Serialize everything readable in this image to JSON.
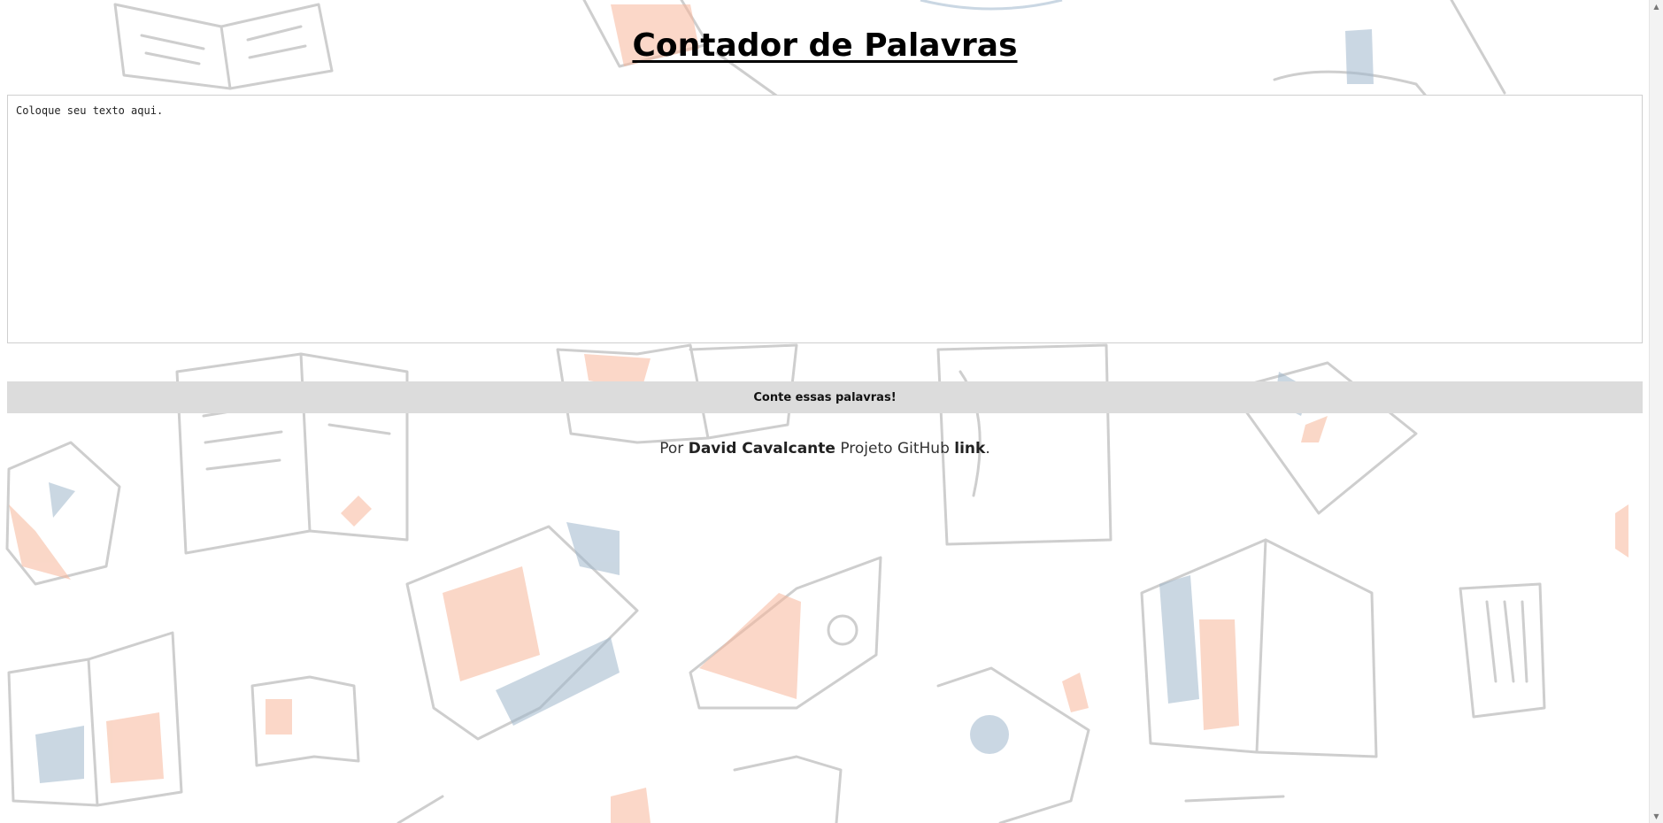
{
  "header": {
    "title": "Contador de Palavras"
  },
  "editor": {
    "placeholder": "Coloque seu texto aqui.",
    "value": ""
  },
  "actions": {
    "count_label": "Conte essas palavras!"
  },
  "footer": {
    "prefix": "Por ",
    "author": "David Cavalcante",
    "middle": " Projeto GitHub ",
    "link_label": "link",
    "suffix": "."
  },
  "theme": {
    "background_art": "doodled-books-pattern",
    "accent_orange": "#f7b79a",
    "accent_blue": "#9fb7cc",
    "button_bg": "#dcdcdc"
  },
  "scrollbar": {
    "up_icon": "scroll-up-arrow",
    "down_icon": "scroll-down-arrow"
  }
}
